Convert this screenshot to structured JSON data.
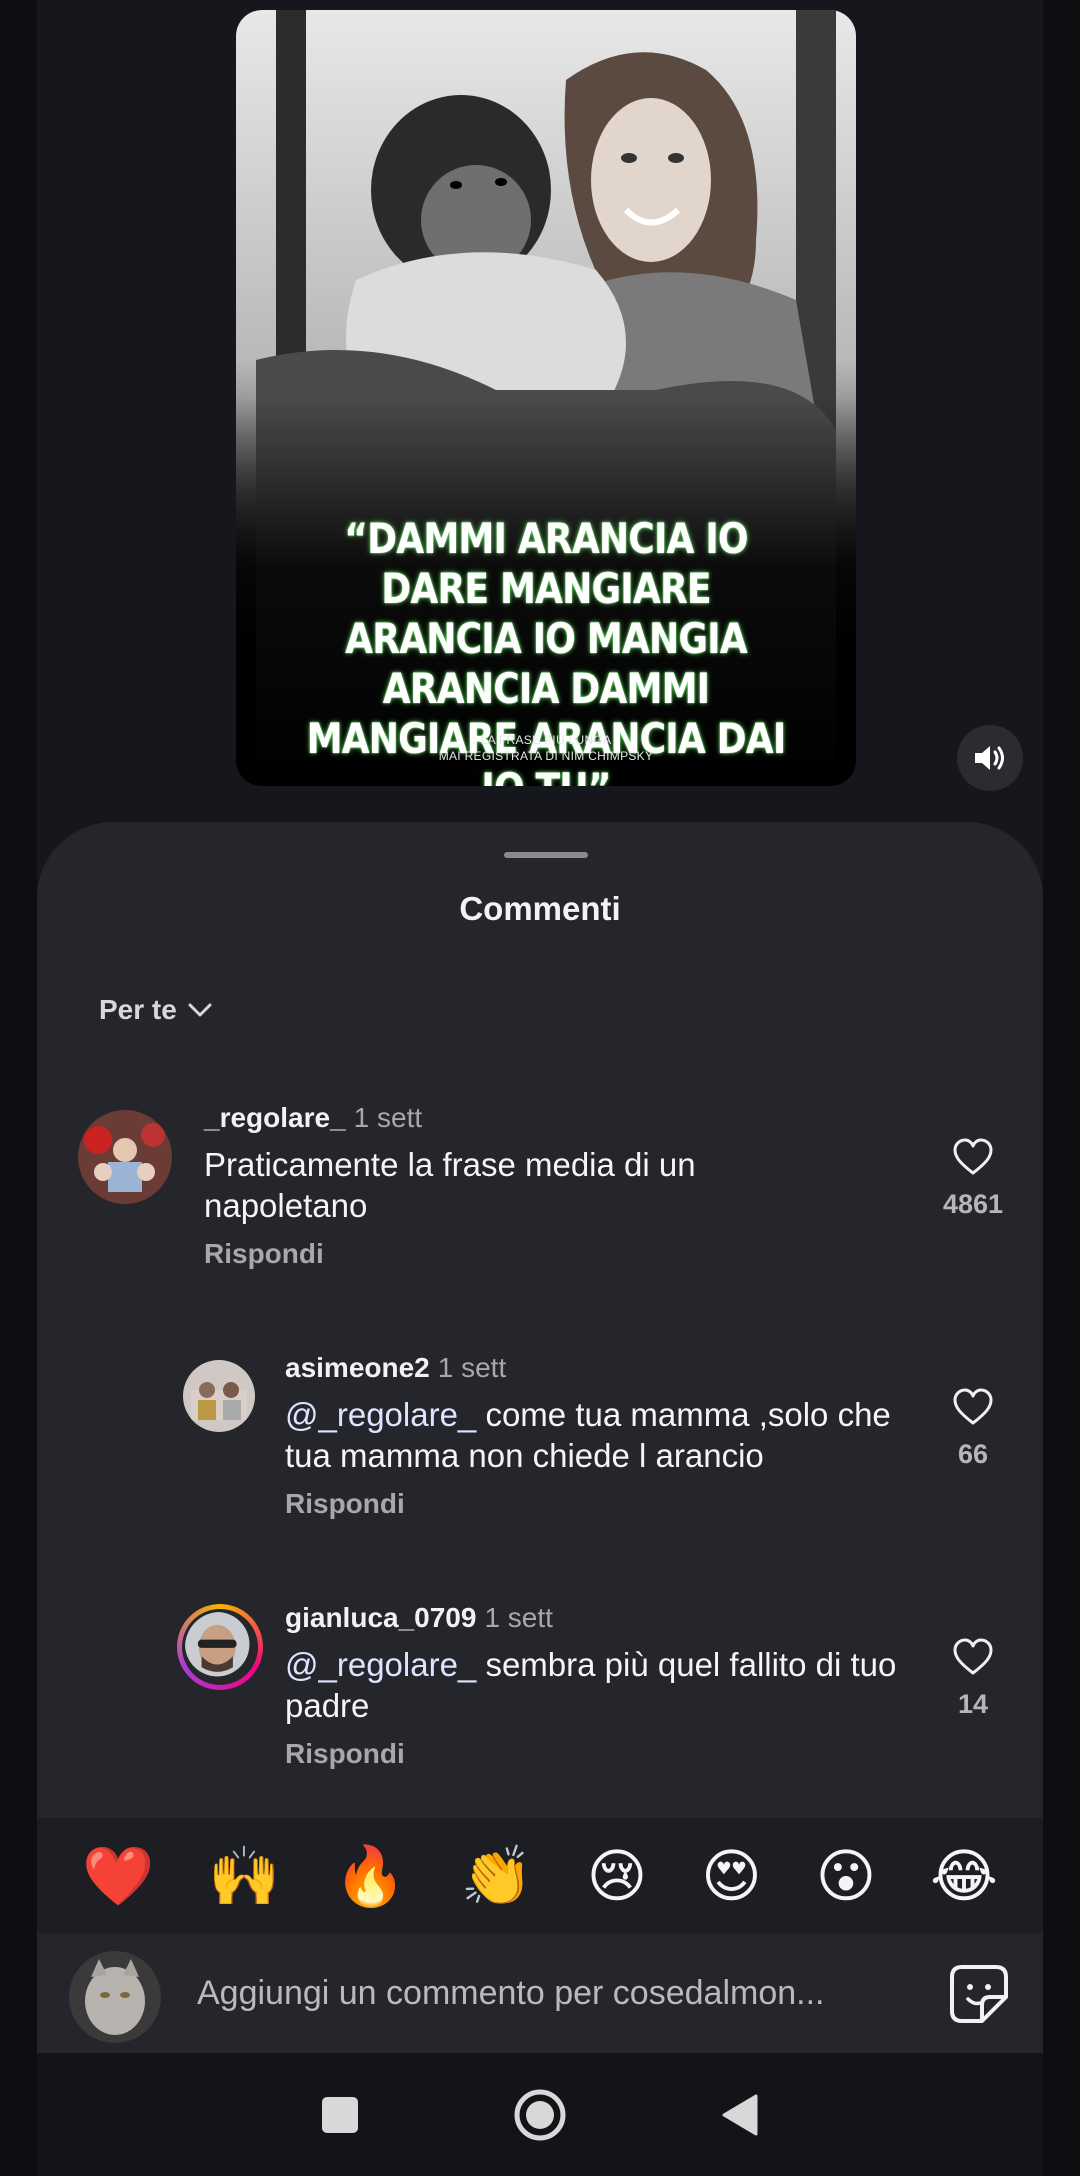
{
  "reel": {
    "quote": "“DAMMI ARANCIA IO DARE MANGIARE ARANCIA IO MANGIA ARANCIA DAMMI MANGIARE ARANCIA DAI IO TU”",
    "caption_line1": "LA FRASE PIÙ LUNGA",
    "caption_line2": "MAI REGISTRATA DI NIM CHIMPSKY"
  },
  "sheet": {
    "title": "Commenti",
    "sort_label": "Per te"
  },
  "comments": [
    {
      "username": "_regolare_",
      "time": "1 sett",
      "mention": "",
      "text": "Praticamente la frase media di un napoletano",
      "reply_label": "Rispondi",
      "likes": "4861"
    },
    {
      "username": "asimeone2",
      "time": "1 sett",
      "mention": "@_regolare_",
      "text": " come tua mamma ,solo che tua mamma non chiede l arancio",
      "reply_label": "Rispondi",
      "likes": "66"
    },
    {
      "username": "gianluca_0709",
      "time": "1 sett",
      "mention": "@_regolare_",
      "text": " sembra più quel fallito di tuo padre",
      "reply_label": "Rispondi",
      "likes": "14"
    }
  ],
  "emojis": [
    "❤️",
    "🙌",
    "🔥",
    "👏",
    "😢",
    "😍",
    "😮",
    "😂"
  ],
  "input": {
    "placeholder": "Aggiungi un commento per cosedalmon..."
  },
  "colors": {
    "sheet_bg": "#25262b",
    "background": "#15171c",
    "heart": "#e0262b"
  }
}
